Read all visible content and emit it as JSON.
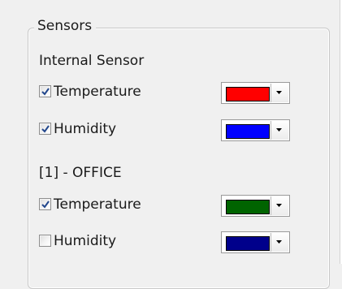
{
  "group": {
    "legend": "Sensors"
  },
  "sections": [
    {
      "title": "Internal Sensor",
      "rows": [
        {
          "label": "Temperature",
          "checked": true,
          "color": "#ff0000"
        },
        {
          "label": "Humidity",
          "checked": true,
          "color": "#0000ff"
        }
      ]
    },
    {
      "title": "[1] - OFFICE",
      "rows": [
        {
          "label": "Temperature",
          "checked": true,
          "color": "#006400"
        },
        {
          "label": "Humidity",
          "checked": false,
          "color": "#00008b"
        }
      ]
    }
  ],
  "icons": {
    "check": "check-icon",
    "dropdown": "chevron-down-icon"
  }
}
